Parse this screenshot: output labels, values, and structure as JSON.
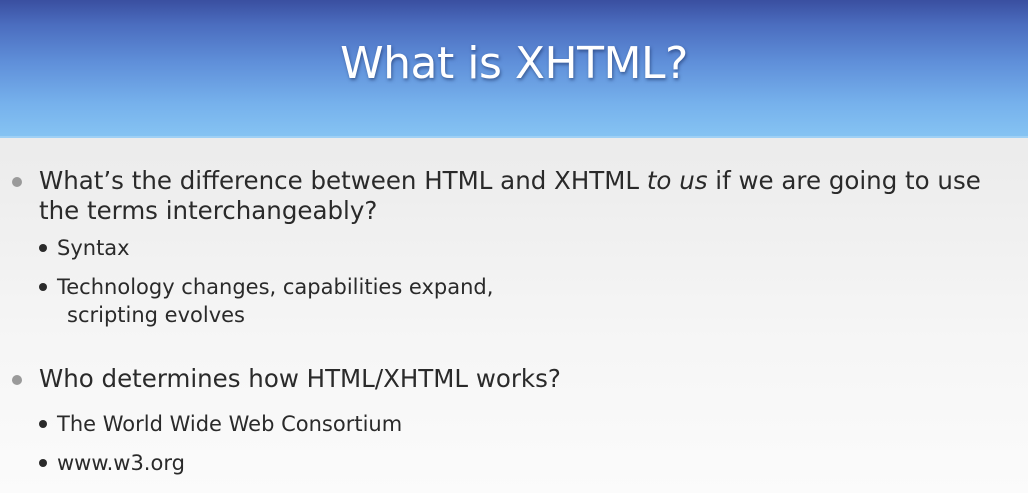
{
  "slide": {
    "title": "What is XHTML?",
    "bullets": [
      {
        "text_before": "What’s the difference between HTML and XHTML ",
        "text_emphasis": "to us",
        "text_after": " if we are going to use the terms interchangeably?",
        "sub": [
          {
            "line1": "Syntax"
          },
          {
            "line1": "Technology changes, capabilities expand,",
            "line2": "scripting evolves"
          }
        ]
      },
      {
        "text": "Who determines how HTML/XHTML works?",
        "sub": [
          {
            "line1": "The World Wide Web Consortium"
          },
          {
            "line1": "www.w3.org"
          }
        ]
      }
    ]
  }
}
